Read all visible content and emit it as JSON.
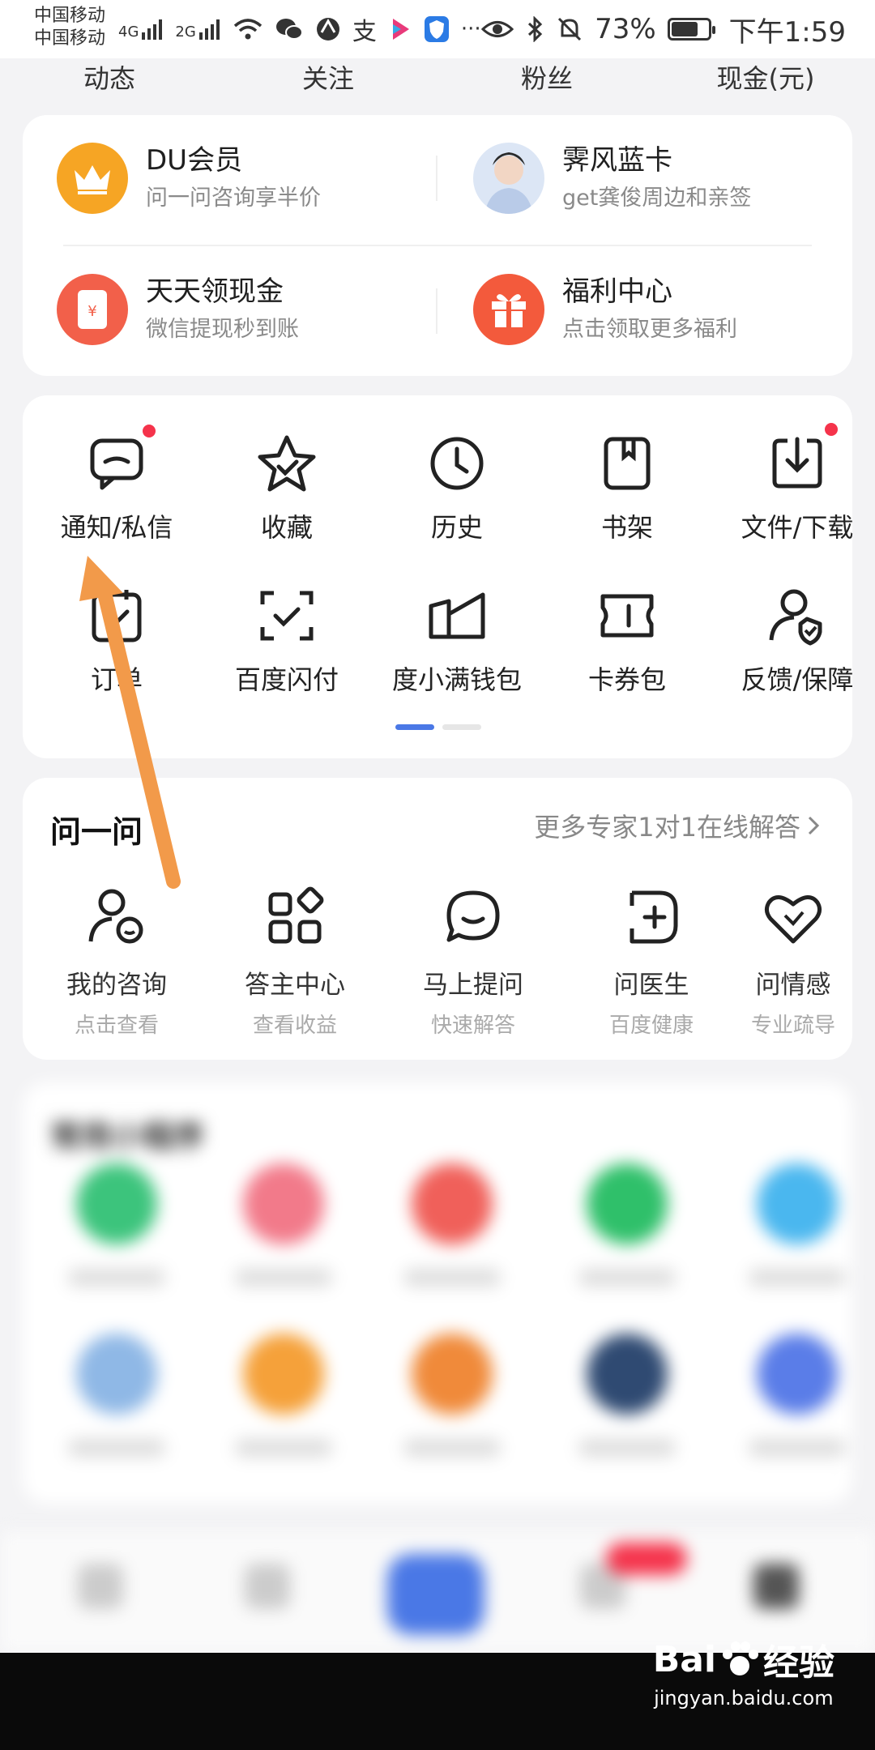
{
  "status_bar": {
    "carrier1": "中国移动",
    "carrier2": "中国移动",
    "net1": "4G",
    "net2": "2G",
    "app_icon_text": "支",
    "more": "···",
    "battery_pct": "73%",
    "battery_level": 0.73,
    "time": "下午1:59"
  },
  "stats": [
    "动态",
    "关注",
    "粉丝",
    "现金(元)"
  ],
  "services": [
    {
      "title": "DU会员",
      "subtitle": "问一问咨询享半价",
      "icon": "crown-icon",
      "color": "#f6a524"
    },
    {
      "title": "霁风蓝卡",
      "subtitle": "get龚俊周边和亲签",
      "icon": "avatar-icon",
      "color": "#b9c9e6"
    },
    {
      "title": "天天领现金",
      "subtitle": "微信提现秒到账",
      "icon": "red-envelope-icon",
      "color": "#f2604a"
    },
    {
      "title": "福利中心",
      "subtitle": "点击领取更多福利",
      "icon": "gift-icon",
      "color": "#f35a3c"
    }
  ],
  "tools": [
    {
      "label": "通知/私信",
      "icon": "message-icon",
      "dot": true
    },
    {
      "label": "收藏",
      "icon": "star-icon",
      "dot": false
    },
    {
      "label": "历史",
      "icon": "clock-icon",
      "dot": false
    },
    {
      "label": "书架",
      "icon": "bookshelf-icon",
      "dot": false
    },
    {
      "label": "文件/下载",
      "icon": "download-icon",
      "dot": true
    },
    {
      "label": "订单",
      "icon": "order-icon",
      "dot": false
    },
    {
      "label": "百度闪付",
      "icon": "scan-pay-icon",
      "dot": false
    },
    {
      "label": "度小满钱包",
      "icon": "wallet-icon",
      "dot": false
    },
    {
      "label": "卡券包",
      "icon": "coupon-icon",
      "dot": false
    },
    {
      "label": "反馈/保障",
      "icon": "feedback-icon",
      "dot": false
    }
  ],
  "ask": {
    "title": "问一问",
    "more": "更多专家1对1在线解答",
    "items": [
      {
        "label": "我的咨询",
        "sub": "点击查看",
        "icon": "consult-icon"
      },
      {
        "label": "答主中心",
        "sub": "查看收益",
        "icon": "apps-icon"
      },
      {
        "label": "马上提问",
        "sub": "快速解答",
        "icon": "chat-icon"
      },
      {
        "label": "问医生",
        "sub": "百度健康",
        "icon": "doctor-icon"
      },
      {
        "label": "问情感",
        "sub": "专业疏导",
        "icon": "heart-icon"
      }
    ]
  },
  "mini_programs": {
    "title": "常用小程序",
    "colors": [
      "#3cc47c",
      "#f27a8a",
      "#f0605a",
      "#2fc06a",
      "#4ab7ef",
      "#8fb8e6",
      "#f5a13a",
      "#f08a3a",
      "#2f4a72",
      "#5a7de8"
    ]
  },
  "watermark": {
    "brand": "Bai",
    "brand_suffix": "经验",
    "url": "jingyan.baidu.com"
  },
  "colors": {
    "accent": "#4a78e6",
    "annotation_arrow": "#f29a4a",
    "badge": "#f5334b"
  }
}
